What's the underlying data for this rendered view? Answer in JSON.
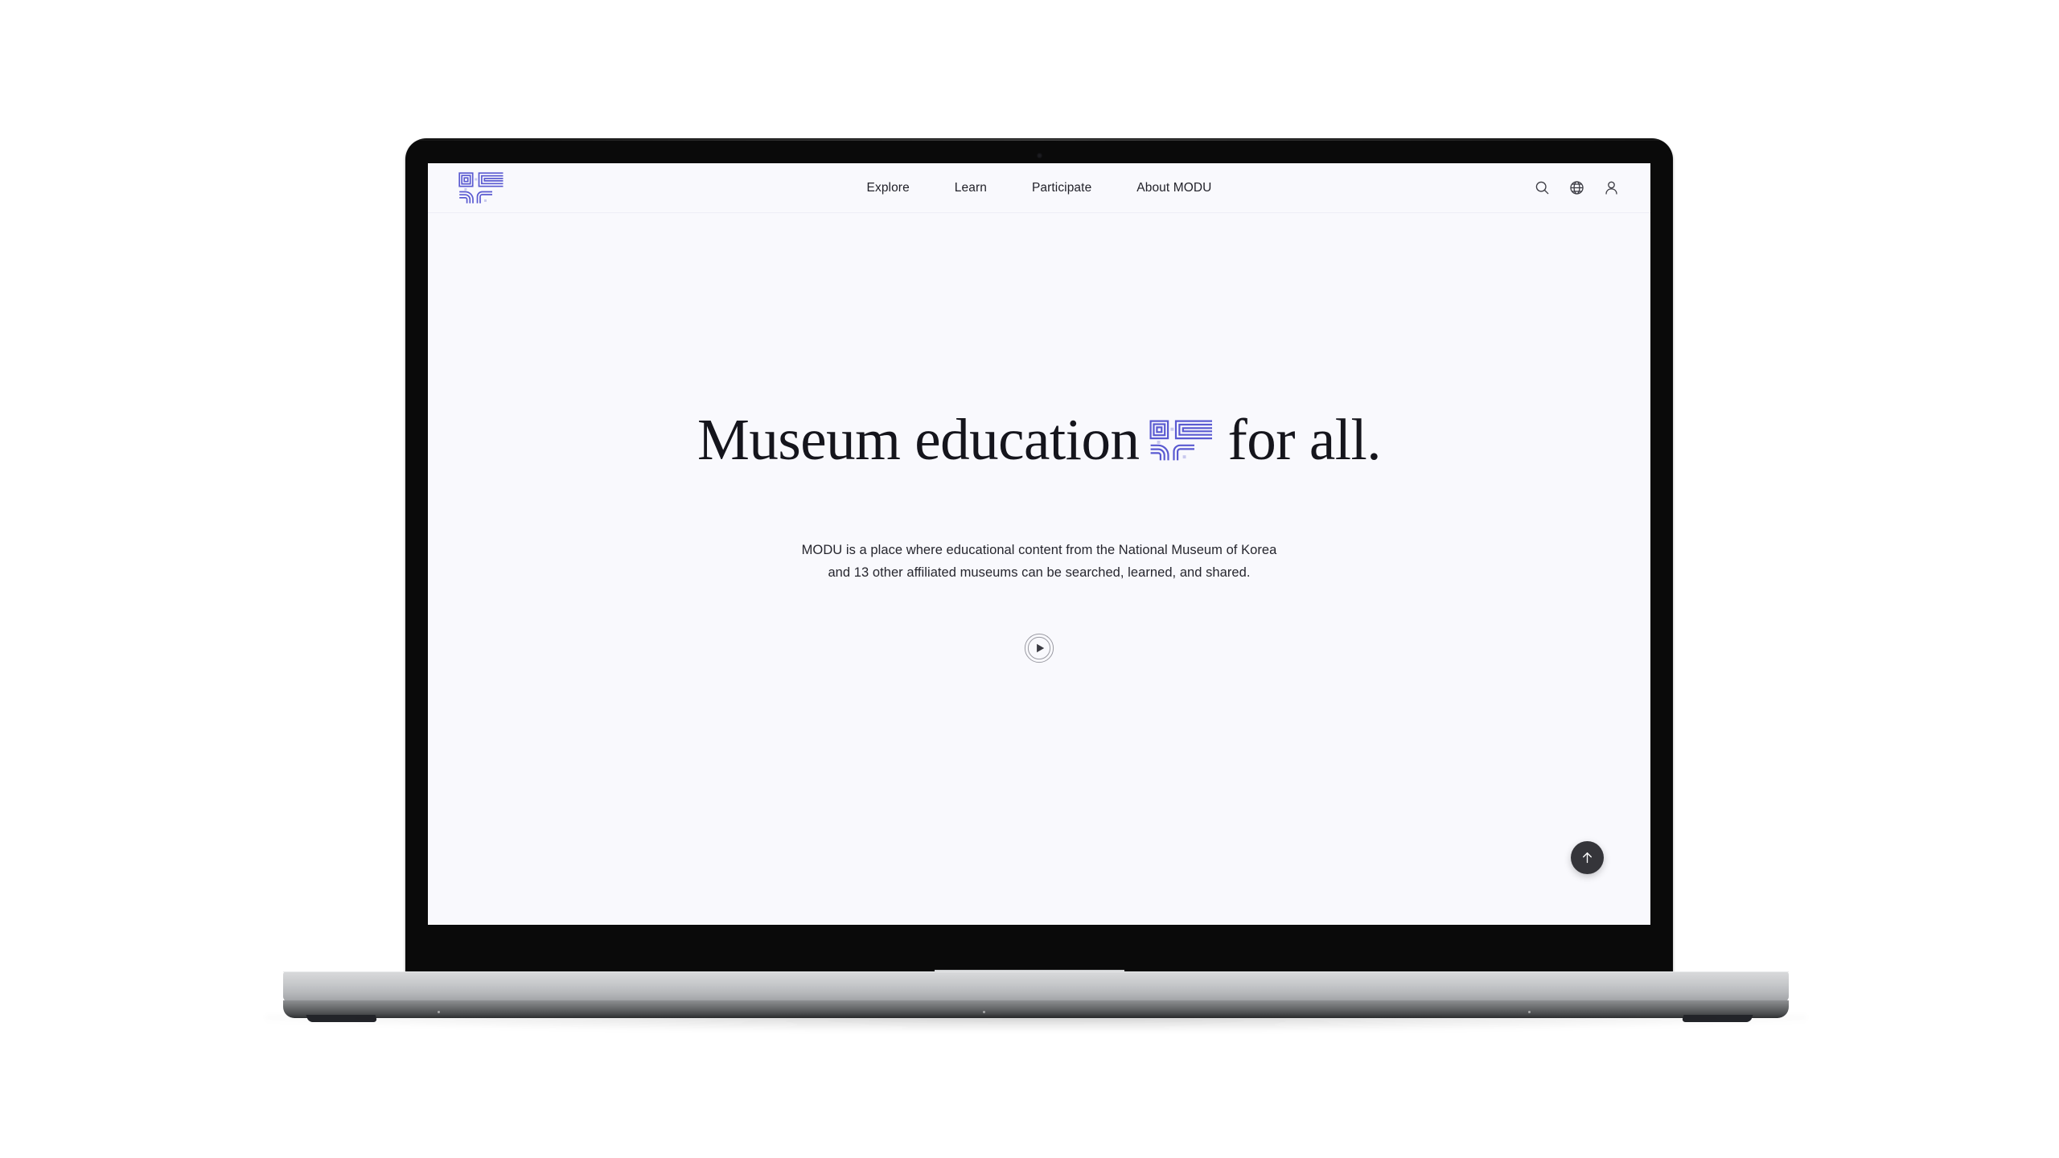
{
  "site": {
    "background_color": "#f9f9fd",
    "brand_color": "#5a5ad1",
    "text_color": "#15151c"
  },
  "header": {
    "logo_name": "modu-logo-mark",
    "nav": [
      {
        "label": "Explore"
      },
      {
        "label": "Learn"
      },
      {
        "label": "Participate"
      },
      {
        "label": "About MODU"
      }
    ],
    "actions": [
      {
        "name": "search-icon",
        "label": "Search"
      },
      {
        "name": "globe-icon",
        "label": "Language"
      },
      {
        "name": "user-icon",
        "label": "Account"
      }
    ]
  },
  "hero": {
    "headline_before": "Museum education",
    "headline_mark": "modu-logo-mark",
    "headline_after": "for all.",
    "subtitle_line1": "MODU is a place where educational content from the National Museum of Korea",
    "subtitle_line2": "and 13 other affiliated museums can be searched, learned, and shared.",
    "play_button_name": "play-video-button"
  },
  "floating": {
    "scroll_top_name": "scroll-to-top-button"
  },
  "device": {
    "type": "laptop-mockup",
    "bezel_color": "#0a0a0a",
    "body_color": "#c6c8ca"
  }
}
